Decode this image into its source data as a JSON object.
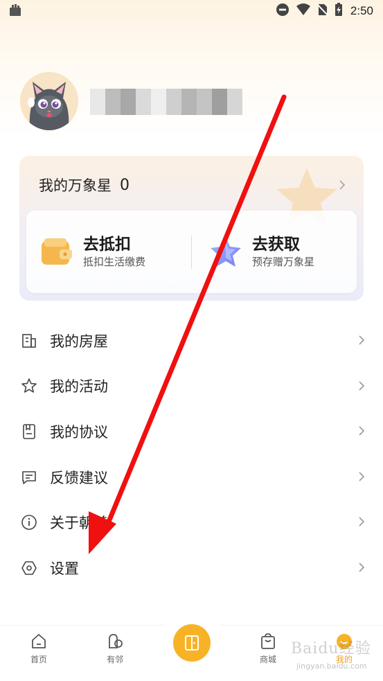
{
  "status_bar": {
    "time": "2:50",
    "icons": [
      "bag-icon",
      "dnd-icon",
      "wifi-icon",
      "no-sim-icon",
      "battery-icon"
    ]
  },
  "profile": {
    "avatar": "cat-avatar",
    "name_state": "blurred"
  },
  "star_card": {
    "title": "我的万象星",
    "count": "0",
    "actions": [
      {
        "title": "去抵扣",
        "subtitle": "抵扣生活缴费",
        "icon": "wallet-icon"
      },
      {
        "title": "去获取",
        "subtitle": "预存赠万象星",
        "icon": "star-icon"
      }
    ]
  },
  "menu": {
    "items": [
      {
        "label": "我的房屋",
        "icon": "building-icon"
      },
      {
        "label": "我的活动",
        "icon": "star-outline-icon"
      },
      {
        "label": "我的协议",
        "icon": "document-icon"
      },
      {
        "label": "反馈建议",
        "icon": "message-icon"
      },
      {
        "label": "关于朝着",
        "icon": "info-icon"
      },
      {
        "label": "设置",
        "icon": "settings-icon"
      }
    ]
  },
  "bottom_nav": {
    "items": [
      {
        "label": "首页",
        "icon": "home-icon"
      },
      {
        "label": "有邻",
        "icon": "neighbor-icon"
      },
      {
        "label": "",
        "icon": "door-icon"
      },
      {
        "label": "商城",
        "icon": "shop-icon"
      },
      {
        "label": "我的",
        "icon": "profile-icon"
      }
    ],
    "active": "我的"
  },
  "watermark": {
    "text": "Baidu经验",
    "sub": "jingyan.baidu.com"
  },
  "colors": {
    "accent": "#f7b325",
    "annotation_arrow": "#f01010",
    "card_bg_top": "#fbf0e3",
    "card_bg_bottom": "#e9ecf8"
  }
}
